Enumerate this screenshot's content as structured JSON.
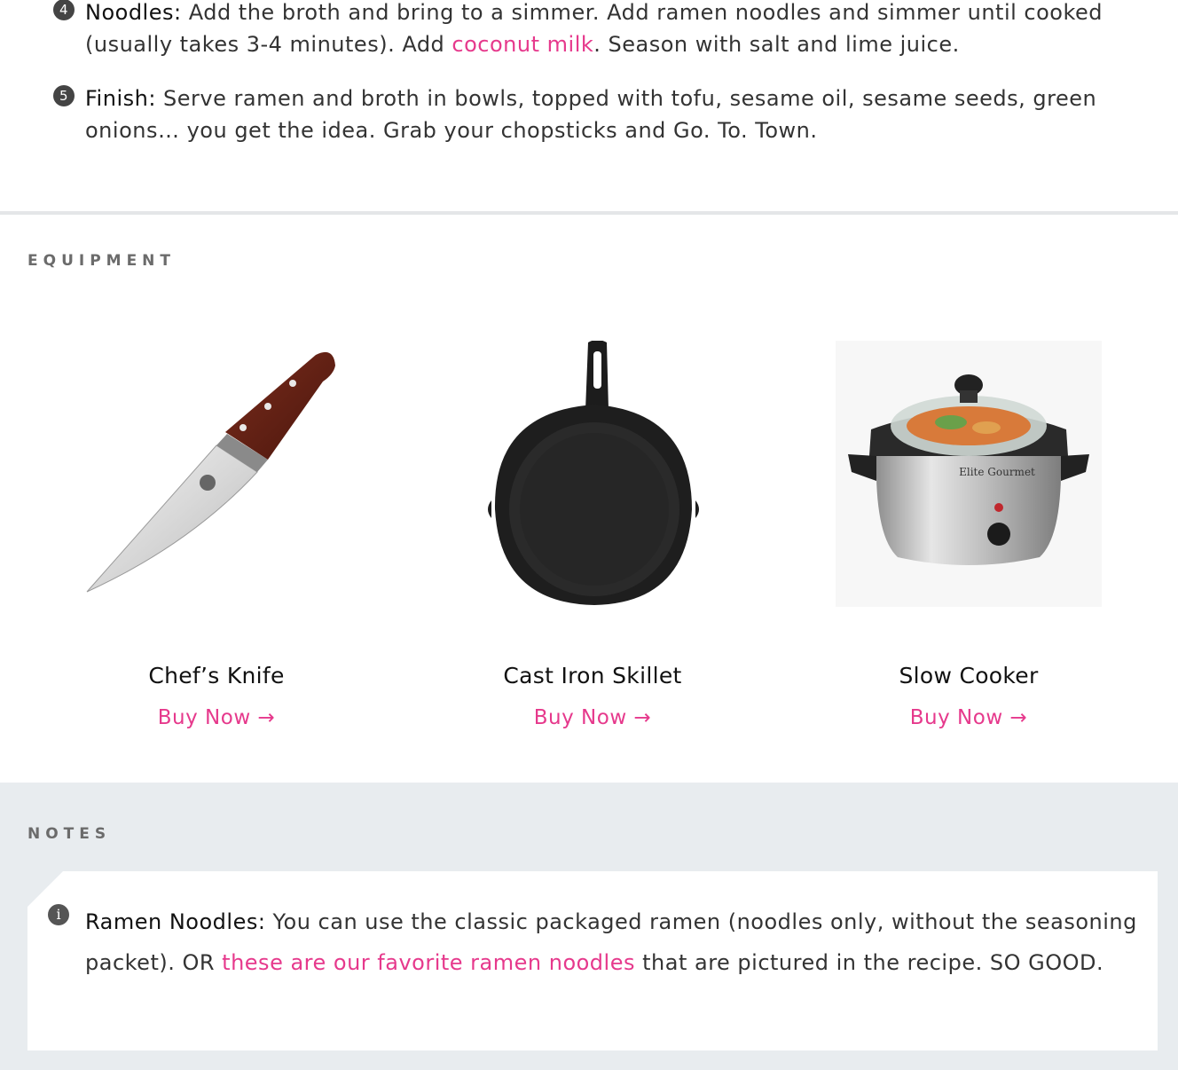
{
  "steps": [
    {
      "number": "4",
      "title": "Noodles:",
      "text_before": " Add the broth and bring to a simmer. Add ramen noodles and simmer until cooked (usually takes 3-4 minutes). Add ",
      "link": "coconut milk",
      "text_after": ". Season with salt and lime juice."
    },
    {
      "number": "5",
      "title": "Finish:",
      "text": " Serve ramen and broth in bowls, topped with tofu, sesame oil, sesame seeds, green onions… you get the idea. Grab your chopsticks and Go. To. Town."
    }
  ],
  "equipment": {
    "heading": "EQUIPMENT",
    "items": [
      {
        "name": "Chef’s Knife",
        "buy": "Buy Now →"
      },
      {
        "name": "Cast Iron Skillet",
        "buy": "Buy Now →"
      },
      {
        "name": "Slow Cooker",
        "buy": "Buy Now →"
      }
    ]
  },
  "notes": {
    "heading": "NOTES",
    "icon": "i",
    "title": "Ramen Noodles:",
    "text_before": " You can use the classic packaged ramen (noodles only, without the seasoning packet). OR ",
    "link": "these are our favorite ramen noodles",
    "text_after": " that are pictured in the recipe. SO GOOD."
  },
  "colors": {
    "accent": "#e6398c",
    "notes_bg": "#e8ecef",
    "divider": "#e4e6e8"
  }
}
